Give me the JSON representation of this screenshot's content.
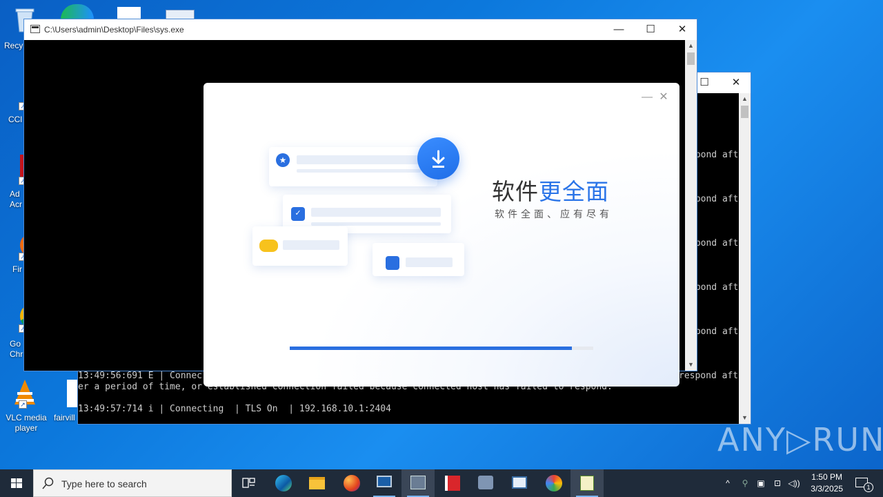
{
  "desktop": {
    "icons": [
      {
        "label": "Recy"
      },
      {
        "label": "CCl"
      },
      {
        "label": "Ad\nAcr"
      },
      {
        "label": "Fir"
      },
      {
        "label": "Go\nChr"
      },
      {
        "label": "VLC media\nplayer"
      },
      {
        "label": "fairvill"
      }
    ]
  },
  "console_front": {
    "title": "C:\\Users\\admin\\Desktop\\Files\\sys.exe",
    "minimize": "—",
    "maximize": "☐",
    "close": "✕"
  },
  "console_back": {
    "maximize": "☐",
    "close": "✕",
    "right_fragments": [
      "spond aft",
      "spond aft",
      "spond aft",
      "spond aft",
      "spond aft",
      "respond aft"
    ],
    "line_a": "13:49:56:691 E | Connec",
    "line_b": "er a period of time, or established connection failed because connected host has failed to respond.",
    "line_c": "13:49:57:714 i | Connecting  | TLS On  | 192.168.10.1:2404"
  },
  "dialog": {
    "headline_plain": "软件",
    "headline_accent": "更全面",
    "subline": "软件全面、应有尽有",
    "minimize": "—",
    "close": "✕",
    "progress": 0.93,
    "accent_color": "#2a74e8"
  },
  "watermark": "ANY▷RUN",
  "taskbar": {
    "search_placeholder": "Type here to search",
    "time": "1:50 PM",
    "date": "3/3/2025",
    "notification_count": "1"
  }
}
